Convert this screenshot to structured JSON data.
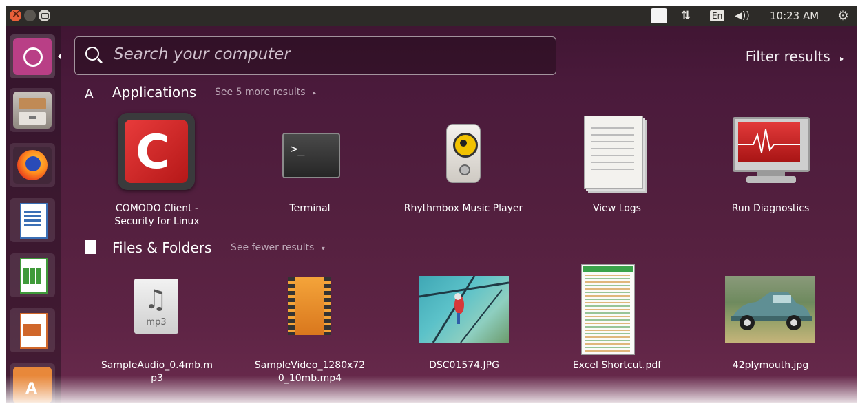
{
  "tray": {
    "keyboard": "En",
    "clock": "10:23 AM"
  },
  "search": {
    "placeholder": "Search your computer"
  },
  "filter": {
    "label": "Filter results"
  },
  "applications": {
    "title": "Applications",
    "more": "See 5 more results",
    "items": [
      {
        "label": "COMODO Client - Security for Linux",
        "icon": "comodo-icon"
      },
      {
        "label": "Terminal",
        "icon": "terminal-icon"
      },
      {
        "label": "Rhythmbox Music Player",
        "icon": "speaker-icon"
      },
      {
        "label": "View Logs",
        "icon": "log-document-icon"
      },
      {
        "label": "Run Diagnostics",
        "icon": "monitor-pulse-icon"
      }
    ]
  },
  "files": {
    "title": "Files & Folders",
    "more": "See fewer results",
    "items": [
      {
        "label": "SampleAudio_0.4mb.mp3",
        "icon": "mp3-file-icon",
        "badge": "mp3"
      },
      {
        "label": "SampleVideo_1280x720_10mb.mp4",
        "icon": "video-file-icon"
      },
      {
        "label": "DSC01574.JPG",
        "icon": "parrot-photo-thumbnail"
      },
      {
        "label": "Excel Shortcut.pdf",
        "icon": "pdf-thumbnail"
      },
      {
        "label": "42plymouth.jpg",
        "icon": "car-photo-thumbnail"
      }
    ]
  }
}
